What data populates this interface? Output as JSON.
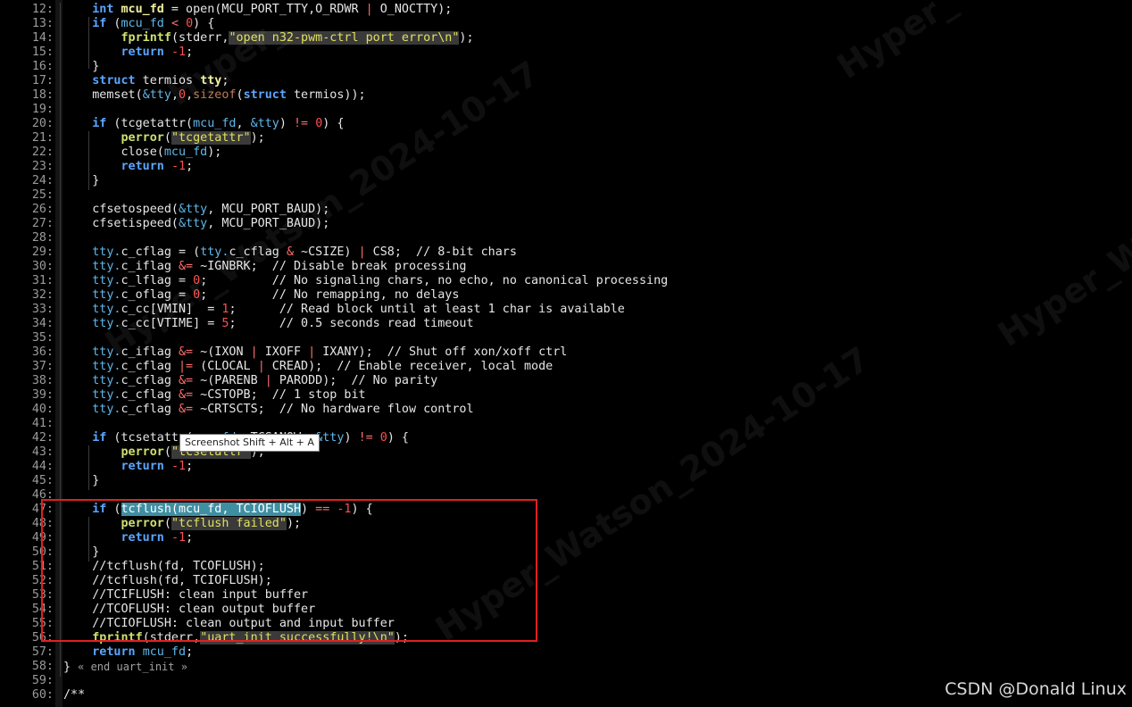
{
  "tooltip": "Screenshot Shift + Alt + A",
  "watermark": {
    "text1": "Hyper_Watson_2024-10-17",
    "text2": "Hyper_Watson_2024-10-17",
    "text3": "Hyper_W",
    "text4": "Hyper_",
    "text5": "Hyper_"
  },
  "csdn_label": "CSDN @Donald Linux",
  "lines": [
    {
      "n": "12",
      "tokens": [
        [
          "    ",
          ""
        ],
        [
          "int",
          "kw"
        ],
        [
          " ",
          ""
        ],
        [
          "mcu_fd",
          "bold"
        ],
        [
          " = open(MCU_PORT_TTY,O_RDWR ",
          ""
        ],
        [
          "|",
          "op"
        ],
        [
          " O_NOCTTY);",
          ""
        ]
      ]
    },
    {
      "n": "13",
      "tokens": [
        [
          "    ",
          ""
        ],
        [
          "if",
          "kw"
        ],
        [
          " (",
          ""
        ],
        [
          "mcu_fd",
          "var"
        ],
        [
          " ",
          ""
        ],
        [
          "<",
          "op"
        ],
        [
          " ",
          ""
        ],
        [
          "0",
          "num"
        ],
        [
          ") {",
          ""
        ]
      ]
    },
    {
      "n": "14",
      "tokens": [
        [
          "        ",
          ""
        ],
        [
          "fprintf",
          "call"
        ],
        [
          "(stderr,",
          ""
        ],
        [
          "\"open n32-pwm-ctrl port error\\n\"",
          "str"
        ],
        [
          ");",
          ""
        ]
      ]
    },
    {
      "n": "15",
      "tokens": [
        [
          "        ",
          ""
        ],
        [
          "return",
          "kw"
        ],
        [
          " ",
          ""
        ],
        [
          "-1",
          "num"
        ],
        [
          ";",
          ""
        ]
      ]
    },
    {
      "n": "16",
      "tokens": [
        [
          "    }",
          ""
        ]
      ]
    },
    {
      "n": "17",
      "tokens": [
        [
          "    ",
          ""
        ],
        [
          "struct",
          "kw"
        ],
        [
          " termios ",
          ""
        ],
        [
          "tty",
          "bold"
        ],
        [
          ";",
          ""
        ]
      ]
    },
    {
      "n": "18",
      "tokens": [
        [
          "    memset(",
          ""
        ],
        [
          "&tty",
          "var"
        ],
        [
          ",",
          ""
        ],
        [
          "0",
          "num"
        ],
        [
          ",",
          ""
        ],
        [
          "sizeof",
          "sizeof"
        ],
        [
          "(",
          ""
        ],
        [
          "struct",
          "kw"
        ],
        [
          " termios));",
          ""
        ]
      ]
    },
    {
      "n": "19",
      "tokens": []
    },
    {
      "n": "20",
      "tokens": [
        [
          "    ",
          ""
        ],
        [
          "if",
          "kw"
        ],
        [
          " (tcgetattr(",
          ""
        ],
        [
          "mcu_fd",
          "var"
        ],
        [
          ", ",
          ""
        ],
        [
          "&tty",
          "var"
        ],
        [
          ") ",
          ""
        ],
        [
          "!=",
          "op"
        ],
        [
          " ",
          ""
        ],
        [
          "0",
          "num"
        ],
        [
          ") {",
          ""
        ]
      ]
    },
    {
      "n": "21",
      "tokens": [
        [
          "        ",
          ""
        ],
        [
          "perror",
          "call"
        ],
        [
          "(",
          ""
        ],
        [
          "\"tcgetattr\"",
          "str"
        ],
        [
          ");",
          ""
        ]
      ]
    },
    {
      "n": "22",
      "tokens": [
        [
          "        close(",
          ""
        ],
        [
          "mcu_fd",
          "var"
        ],
        [
          ");",
          ""
        ]
      ]
    },
    {
      "n": "23",
      "tokens": [
        [
          "        ",
          ""
        ],
        [
          "return",
          "kw"
        ],
        [
          " ",
          ""
        ],
        [
          "-1",
          "num"
        ],
        [
          ";",
          ""
        ]
      ]
    },
    {
      "n": "24",
      "tokens": [
        [
          "    }",
          ""
        ]
      ]
    },
    {
      "n": "25",
      "tokens": []
    },
    {
      "n": "26",
      "tokens": [
        [
          "    cfsetospeed(",
          ""
        ],
        [
          "&tty",
          "var"
        ],
        [
          ", MCU_PORT_BAUD);",
          ""
        ]
      ]
    },
    {
      "n": "27",
      "tokens": [
        [
          "    cfsetispeed(",
          ""
        ],
        [
          "&tty",
          "var"
        ],
        [
          ", MCU_PORT_BAUD);",
          ""
        ]
      ]
    },
    {
      "n": "28",
      "tokens": []
    },
    {
      "n": "29",
      "tokens": [
        [
          "    ",
          ""
        ],
        [
          "tty.",
          "var"
        ],
        [
          "c_cflag = (",
          ""
        ],
        [
          "tty.",
          "var"
        ],
        [
          "c_cflag ",
          ""
        ],
        [
          "&",
          "op"
        ],
        [
          " ~CSIZE) ",
          ""
        ],
        [
          "|",
          "op"
        ],
        [
          " CS8;  // 8-bit chars",
          ""
        ]
      ]
    },
    {
      "n": "30",
      "tokens": [
        [
          "    ",
          ""
        ],
        [
          "tty.",
          "var"
        ],
        [
          "c_iflag ",
          ""
        ],
        [
          "&=",
          "op"
        ],
        [
          " ~IGNBRK;  // Disable break processing",
          ""
        ]
      ]
    },
    {
      "n": "31",
      "tokens": [
        [
          "    ",
          ""
        ],
        [
          "tty.",
          "var"
        ],
        [
          "c_lflag = ",
          ""
        ],
        [
          "0",
          "num"
        ],
        [
          ";         // No signaling chars, no echo, no canonical processing",
          ""
        ]
      ]
    },
    {
      "n": "32",
      "tokens": [
        [
          "    ",
          ""
        ],
        [
          "tty.",
          "var"
        ],
        [
          "c_oflag = ",
          ""
        ],
        [
          "0",
          "num"
        ],
        [
          ";         // No remapping, no delays",
          ""
        ]
      ]
    },
    {
      "n": "33",
      "tokens": [
        [
          "    ",
          ""
        ],
        [
          "tty.",
          "var"
        ],
        [
          "c_cc[VMIN]  = ",
          ""
        ],
        [
          "1",
          "num"
        ],
        [
          ";      // Read block until at least 1 char is available",
          ""
        ]
      ]
    },
    {
      "n": "34",
      "tokens": [
        [
          "    ",
          ""
        ],
        [
          "tty.",
          "var"
        ],
        [
          "c_cc[VTIME] = ",
          ""
        ],
        [
          "5",
          "num"
        ],
        [
          ";      // 0.5 seconds read timeout",
          ""
        ]
      ]
    },
    {
      "n": "35",
      "tokens": []
    },
    {
      "n": "36",
      "tokens": [
        [
          "    ",
          ""
        ],
        [
          "tty.",
          "var"
        ],
        [
          "c_iflag ",
          ""
        ],
        [
          "&=",
          "op"
        ],
        [
          " ~(IXON ",
          ""
        ],
        [
          "|",
          "op"
        ],
        [
          " IXOFF ",
          ""
        ],
        [
          "|",
          "op"
        ],
        [
          " IXANY);  // Shut off xon/xoff ctrl",
          ""
        ]
      ]
    },
    {
      "n": "37",
      "tokens": [
        [
          "    ",
          ""
        ],
        [
          "tty.",
          "var"
        ],
        [
          "c_cflag ",
          ""
        ],
        [
          "|=",
          "op"
        ],
        [
          " (CLOCAL ",
          ""
        ],
        [
          "|",
          "op"
        ],
        [
          " CREAD);  // Enable receiver, local mode",
          ""
        ]
      ]
    },
    {
      "n": "38",
      "tokens": [
        [
          "    ",
          ""
        ],
        [
          "tty.",
          "var"
        ],
        [
          "c_cflag ",
          ""
        ],
        [
          "&=",
          "op"
        ],
        [
          " ~(PARENB ",
          ""
        ],
        [
          "|",
          "op"
        ],
        [
          " PARODD);  // No parity",
          ""
        ]
      ]
    },
    {
      "n": "39",
      "tokens": [
        [
          "    ",
          ""
        ],
        [
          "tty.",
          "var"
        ],
        [
          "c_cflag ",
          ""
        ],
        [
          "&=",
          "op"
        ],
        [
          " ~CSTOPB;  // 1 stop bit",
          ""
        ]
      ]
    },
    {
      "n": "40",
      "tokens": [
        [
          "    ",
          ""
        ],
        [
          "tty.",
          "var"
        ],
        [
          "c_cflag ",
          ""
        ],
        [
          "&=",
          "op"
        ],
        [
          " ~CRTSCTS;  // No hardware flow control",
          ""
        ]
      ]
    },
    {
      "n": "41",
      "tokens": []
    },
    {
      "n": "42",
      "tokens": [
        [
          "    ",
          ""
        ],
        [
          "if",
          "kw"
        ],
        [
          " (tcsetattr(",
          ""
        ],
        [
          "mcu_fd",
          "var"
        ],
        [
          ", TCSANOW, ",
          ""
        ],
        [
          "&tty",
          "var"
        ],
        [
          ") ",
          ""
        ],
        [
          "!=",
          "op"
        ],
        [
          " ",
          ""
        ],
        [
          "0",
          "num"
        ],
        [
          ") {",
          ""
        ]
      ]
    },
    {
      "n": "43",
      "tokens": [
        [
          "        ",
          ""
        ],
        [
          "perror",
          "call"
        ],
        [
          "(",
          ""
        ],
        [
          "\"tcsetattr\"",
          "str"
        ],
        [
          ");",
          ""
        ]
      ]
    },
    {
      "n": "44",
      "tokens": [
        [
          "        ",
          ""
        ],
        [
          "return",
          "kw"
        ],
        [
          " ",
          ""
        ],
        [
          "-1",
          "num"
        ],
        [
          ";",
          ""
        ]
      ]
    },
    {
      "n": "45",
      "tokens": [
        [
          "    }",
          ""
        ]
      ]
    },
    {
      "n": "46",
      "tokens": []
    },
    {
      "n": "47",
      "tokens": [
        [
          "    ",
          ""
        ],
        [
          "if",
          "kw"
        ],
        [
          " (",
          ""
        ],
        [
          "tcflush(mcu_fd, TCIOFLUSH",
          "hl"
        ],
        [
          ") ",
          ""
        ],
        [
          "==",
          "op"
        ],
        [
          " ",
          ""
        ],
        [
          "-1",
          "num"
        ],
        [
          ") {",
          ""
        ]
      ]
    },
    {
      "n": "48",
      "tokens": [
        [
          "        ",
          ""
        ],
        [
          "perror",
          "call"
        ],
        [
          "(",
          ""
        ],
        [
          "\"tcflush failed\"",
          "str"
        ],
        [
          ");",
          ""
        ]
      ]
    },
    {
      "n": "49",
      "tokens": [
        [
          "        ",
          ""
        ],
        [
          "return",
          "kw"
        ],
        [
          " ",
          ""
        ],
        [
          "-1",
          "num"
        ],
        [
          ";",
          ""
        ]
      ]
    },
    {
      "n": "50",
      "tokens": [
        [
          "    }",
          ""
        ]
      ]
    },
    {
      "n": "51",
      "tokens": [
        [
          "    //tcflush(fd, TCOFLUSH);",
          ""
        ]
      ]
    },
    {
      "n": "52",
      "tokens": [
        [
          "    //tcflush(fd, TCIOFLUSH);",
          ""
        ]
      ]
    },
    {
      "n": "53",
      "tokens": [
        [
          "    //TCIFLUSH: clean input buffer",
          ""
        ]
      ]
    },
    {
      "n": "54",
      "tokens": [
        [
          "    //TCOFLUSH: clean output buffer",
          ""
        ]
      ]
    },
    {
      "n": "55",
      "tokens": [
        [
          "    //TCIOFLUSH: clean output and input buffer",
          ""
        ]
      ]
    },
    {
      "n": "56",
      "tokens": [
        [
          "    ",
          ""
        ],
        [
          "fprintf",
          "call"
        ],
        [
          "(stderr,",
          ""
        ],
        [
          "\"uart_init successfully!\\n\"",
          "str"
        ],
        [
          ");",
          ""
        ]
      ]
    },
    {
      "n": "57",
      "tokens": [
        [
          "    ",
          ""
        ],
        [
          "return",
          "kw"
        ],
        [
          " ",
          ""
        ],
        [
          "mcu_fd",
          "var"
        ],
        [
          ";",
          ""
        ]
      ]
    },
    {
      "n": "58",
      "tokens": [
        [
          "} ",
          ""
        ],
        [
          "« end uart_init »",
          "endmark"
        ]
      ]
    },
    {
      "n": "59",
      "tokens": []
    },
    {
      "n": "60",
      "tokens": [
        [
          "/**",
          ""
        ]
      ]
    }
  ]
}
